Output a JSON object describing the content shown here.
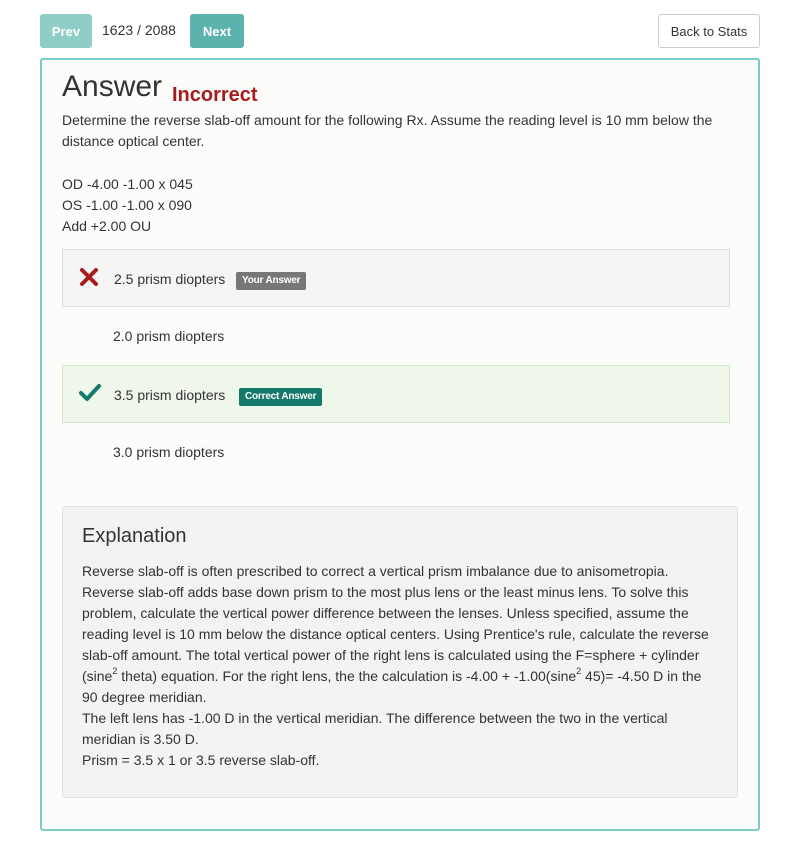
{
  "nav": {
    "prev_label": "Prev",
    "counter": "1623 / 2088",
    "next_label": "Next",
    "back_label": "Back to Stats"
  },
  "answer": {
    "heading": "Answer",
    "status": "Incorrect",
    "question": "Determine the reverse slab-off amount for the following Rx. Assume the reading level is 10 mm below the distance optical center.",
    "rx_lines": [
      "OD -4.00 -1.00 x 045",
      "OS -1.00 -1.00 x 090",
      "Add +2.00 OU"
    ]
  },
  "options": [
    {
      "text": "2.5 prism diopters",
      "badge": "Your Answer",
      "state": "incorrect",
      "icon": "x-mark-icon"
    },
    {
      "text": "2.0 prism diopters",
      "badge": "",
      "state": "neutral",
      "icon": ""
    },
    {
      "text": "3.5 prism diopters",
      "badge": "Correct Answer",
      "state": "correct",
      "icon": "checkmark-icon"
    },
    {
      "text": "3.0 prism diopters",
      "badge": "",
      "state": "neutral",
      "icon": ""
    }
  ],
  "explanation": {
    "title": "Explanation",
    "lines": [
      "Reverse slab-off is often prescribed to correct a vertical prism imbalance due to anisometropia.",
      "Reverse slab-off adds base down prism to the most plus lens or the least minus lens. To solve this",
      "problem, calculate the vertical power difference between the lenses. Unless specified, assume the",
      "reading level is 10 mm below the distance optical centers. Using Prentice's rule, calculate the reverse",
      "slab-off amount. The total vertical power of the right lens is calculated using the F=sphere + cylinder",
      {
        "pre": "(sine",
        "sup": "2",
        "post": " theta) equation. For the right lens, the the calculation is -4.00 + -1.00(sine",
        "sup2": "2",
        "post2": " 45)= -4.50 D in the"
      },
      "90 degree meridian.",
      "The left lens has -1.00 D in the vertical meridian. The difference between the two in the vertical",
      "meridian is 3.50 D.",
      "Prism = 3.5 x 1 or 3.5 reverse slab-off."
    ]
  },
  "colors": {
    "accent_teal": "#5cb3ad",
    "card_border": "#7acdc6",
    "incorrect_red": "#a61c1c",
    "correct_green": "#14786b",
    "correct_bg": "#eef7e9",
    "your_answer_badge": "#777777"
  }
}
